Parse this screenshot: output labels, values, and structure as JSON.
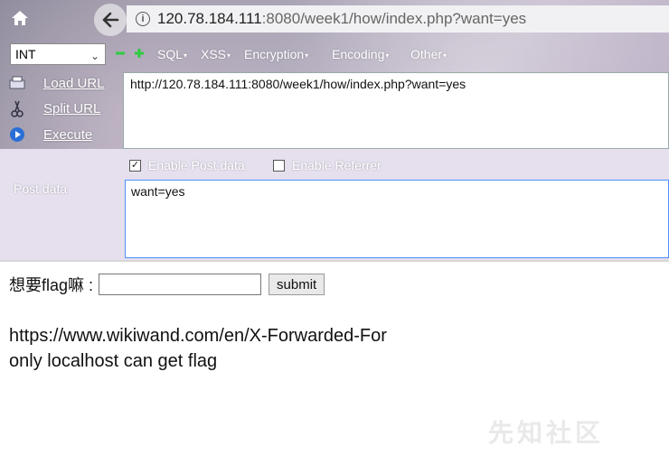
{
  "browser": {
    "url_host": "120.78.184.111",
    "url_rest": ":8080/week1/how/index.php?want=yes",
    "home_icon": "home-icon",
    "back_icon": "back-arrow-icon",
    "info_icon": "info-icon"
  },
  "hackbar": {
    "select_value": "INT",
    "menus": [
      "SQL",
      "XSS",
      "Encryption",
      "Encoding",
      "Other"
    ],
    "side": {
      "load_url": "Load URL",
      "split_url": "Split URL",
      "execute": "Execute"
    },
    "url_value": "http://120.78.184.111:8080/week1/how/index.php?want=yes",
    "enable_post": "Enable Post data",
    "enable_referrer": "Enable Referrer",
    "post_label": "Post data",
    "post_value": "want=yes"
  },
  "page": {
    "form_label": "想要flag嘛 :",
    "input_value": "",
    "submit_label": "submit",
    "line1": "https://www.wikiwand.com/en/X-Forwarded-For",
    "line2": "only localhost can get flag"
  },
  "watermark": "先知社区"
}
